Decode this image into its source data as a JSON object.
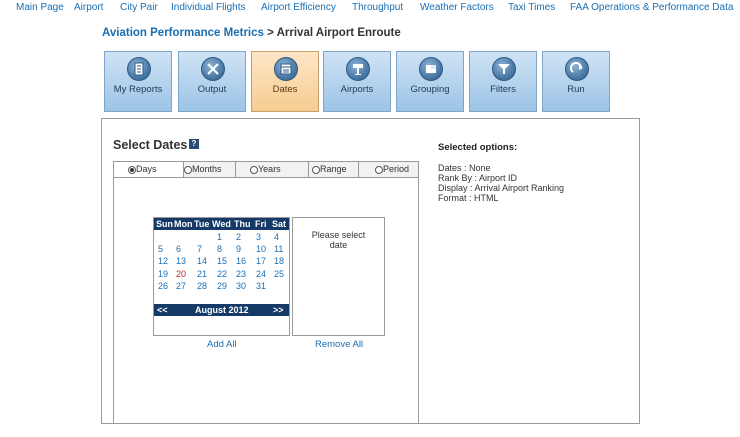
{
  "topnav": [
    "Main Page",
    "Airport",
    "City Pair",
    "Individual Flights",
    "Airport Efficiency",
    "Throughput",
    "Weather Factors",
    "Taxi Times",
    "FAA Operations & Performance Data"
  ],
  "breadcrumb": {
    "root": "Aviation Performance Metrics",
    "separator": " > ",
    "current": "Arrival Airport Enroute"
  },
  "tabs": [
    {
      "label": "My Reports",
      "icon": "report-icon"
    },
    {
      "label": "Output",
      "icon": "tools-icon"
    },
    {
      "label": "Dates",
      "icon": "calendar-icon",
      "active": true
    },
    {
      "label": "Airports",
      "icon": "tower-icon"
    },
    {
      "label": "Grouping",
      "icon": "grouping-icon"
    },
    {
      "label": "Filters",
      "icon": "filter-icon"
    },
    {
      "label": "Run",
      "icon": "run-icon"
    }
  ],
  "select_dates": {
    "title": "Select Dates",
    "help": "?"
  },
  "subtabs": [
    "Days",
    "Months",
    "Years",
    "Range",
    "Period"
  ],
  "calendar": {
    "weekdays": [
      "Sun",
      "Mon",
      "Tue",
      "Wed",
      "Thu",
      "Fri",
      "Sat"
    ],
    "month": "August 2012",
    "prev": "<<",
    "next": ">>",
    "weeks": [
      [
        "",
        "",
        "",
        "1",
        "2",
        "3",
        "4"
      ],
      [
        "5",
        "6",
        "7",
        "8",
        "9",
        "10",
        "11"
      ],
      [
        "12",
        "13",
        "14",
        "15",
        "16",
        "17",
        "18"
      ],
      [
        "19",
        "20",
        "21",
        "22",
        "23",
        "24",
        "25"
      ],
      [
        "26",
        "27",
        "28",
        "29",
        "30",
        "31",
        ""
      ]
    ],
    "highlight_day": "20",
    "highlight_color": "#c0282a"
  },
  "selection_box": {
    "message": "Please select date"
  },
  "actions": {
    "add_all": "Add All",
    "remove_all": "Remove All"
  },
  "selected_options": {
    "title": "Selected options:",
    "lines": [
      "Dates : None",
      "Rank By : Airport ID",
      "Display : Arrival Airport Ranking",
      "Format : HTML"
    ]
  },
  "colors": {
    "link": "#1a6fb3",
    "calendar_header": "#153a67",
    "active_tab": "#f6cc91",
    "tab": "#9cc4e6"
  }
}
